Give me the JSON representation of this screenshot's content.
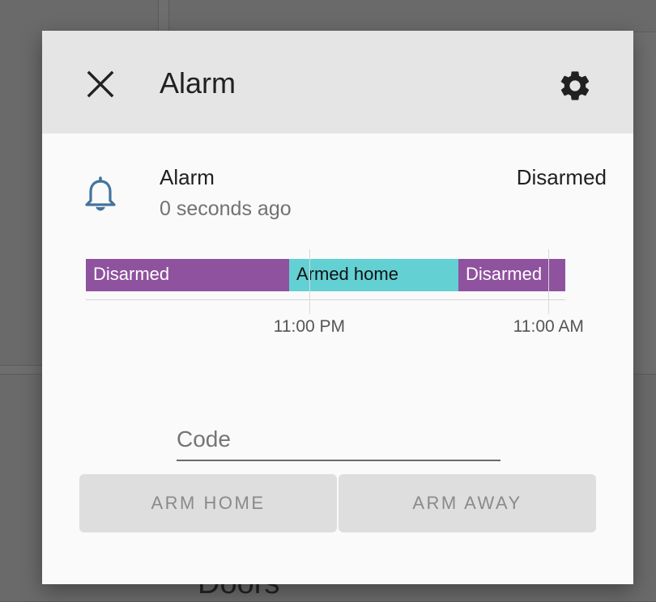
{
  "background": {
    "partial_text": "Doors"
  },
  "dialog": {
    "title": "Alarm",
    "close_icon": "close-icon",
    "settings_icon": "gear-icon"
  },
  "entity": {
    "icon": "bell-icon",
    "name": "Alarm",
    "last_changed": "0 seconds ago",
    "state": "Disarmed"
  },
  "chart_data": {
    "type": "timeline",
    "segments": [
      {
        "label": "Disarmed",
        "color": "#8f529e",
        "start": 0.0,
        "end": 0.424
      },
      {
        "label": "Armed home",
        "color": "#63d0d3",
        "start": 0.424,
        "end": 0.777
      },
      {
        "label": "Disarmed",
        "color": "#8f529e",
        "start": 0.777,
        "end": 1.0
      }
    ],
    "ticks": [
      {
        "label": "11:00 PM",
        "at": 0.466
      },
      {
        "label": "11:00 AM",
        "at": 0.965
      }
    ]
  },
  "code": {
    "placeholder": "Code",
    "value": ""
  },
  "buttons": {
    "arm_home": "ARM HOME",
    "arm_away": "ARM AWAY"
  }
}
